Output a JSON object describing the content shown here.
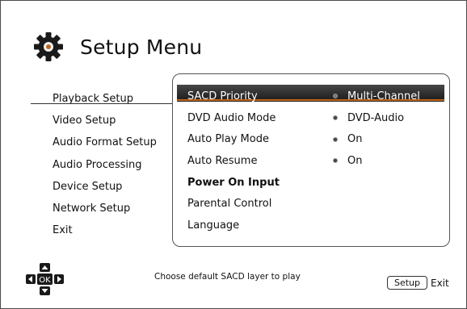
{
  "header": {
    "title": "Setup Menu"
  },
  "left_menu": {
    "items": [
      "Playback Setup",
      "Video Setup",
      "Audio Format Setup",
      "Audio Processing",
      "Device Setup",
      "Network Setup",
      "Exit"
    ],
    "selected_index": 0
  },
  "settings": {
    "items": [
      {
        "label": "SACD Priority",
        "value": "Multi-Channel"
      },
      {
        "label": "DVD Audio Mode",
        "value": "DVD-Audio"
      },
      {
        "label": "Auto Play Mode",
        "value": "On"
      },
      {
        "label": "Auto Resume",
        "value": "On"
      },
      {
        "label": "Power On Input",
        "value": ""
      },
      {
        "label": "Parental Control",
        "value": ""
      },
      {
        "label": "Language",
        "value": ""
      }
    ],
    "selected_index": 0
  },
  "footer": {
    "hint": "Choose default SACD layer to play",
    "setup_button": "Setup",
    "exit_label": "Exit",
    "nav_ok": "OK"
  },
  "colors": {
    "accent": "#c1661a",
    "highlight": "#2e2e2e"
  }
}
